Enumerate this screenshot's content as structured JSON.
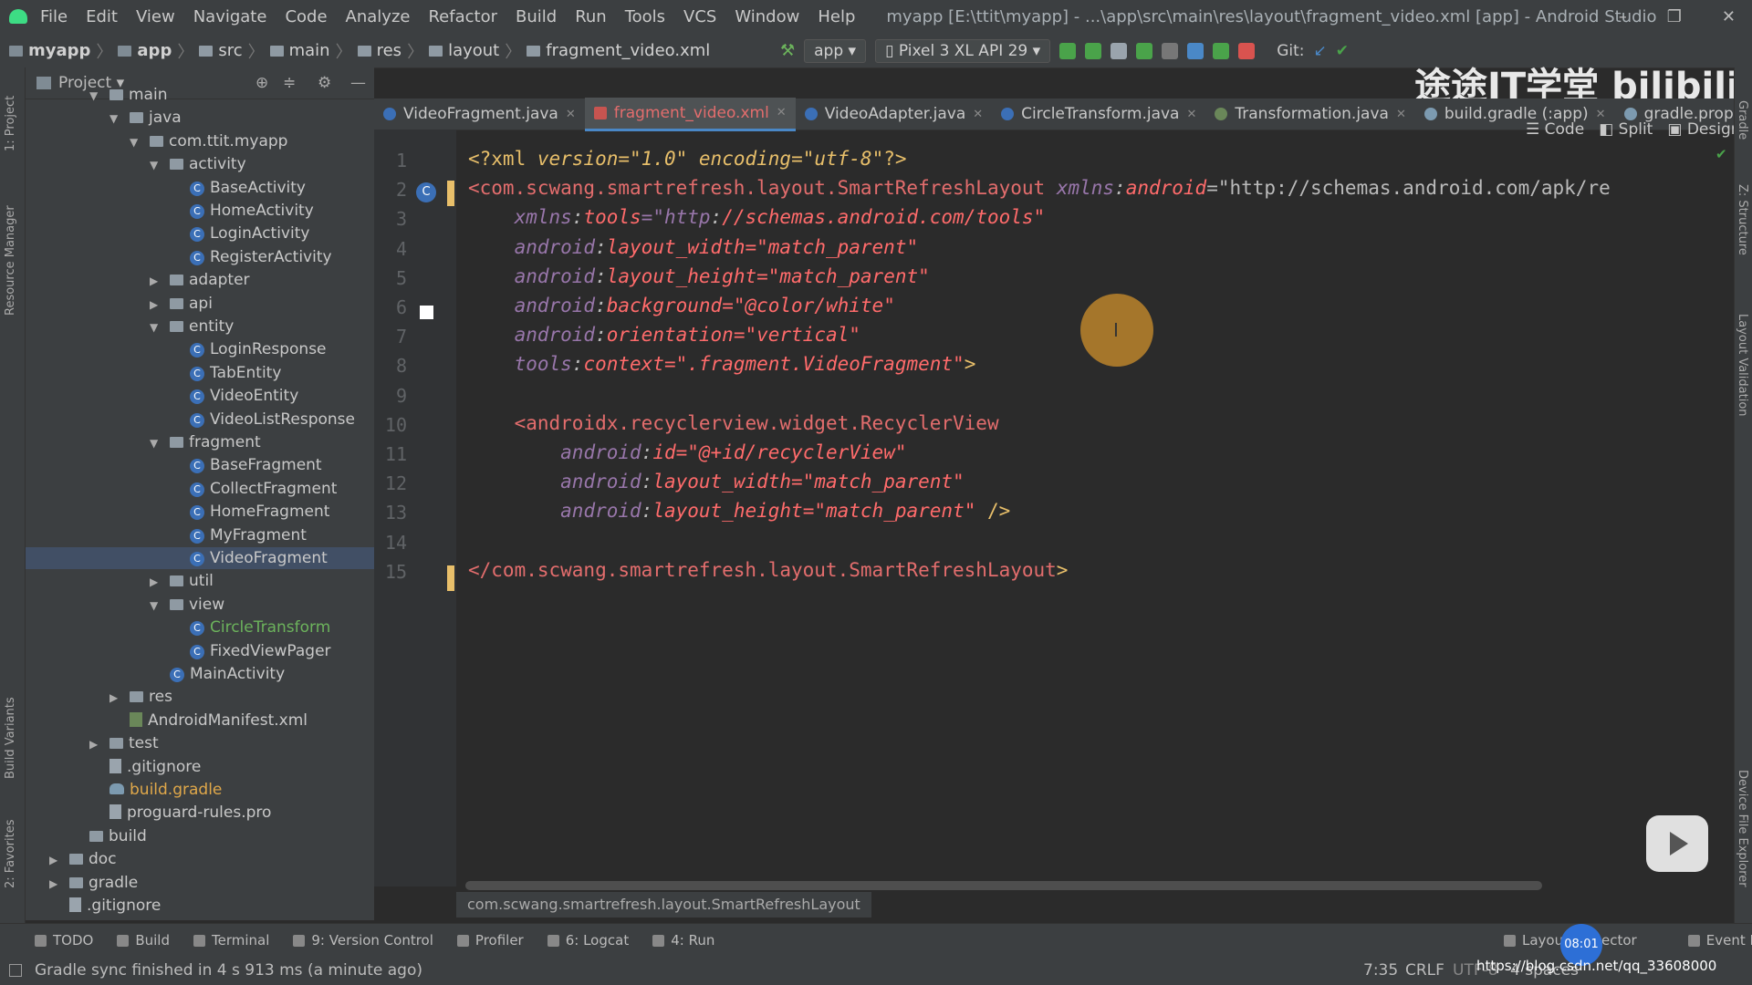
{
  "window": {
    "menu": [
      "File",
      "Edit",
      "View",
      "Navigate",
      "Code",
      "Analyze",
      "Refactor",
      "Build",
      "Run",
      "Tools",
      "VCS",
      "Window",
      "Help"
    ],
    "title": "myapp [E:\\ttit\\myapp] - ...\\app\\src\\main\\res\\layout\\fragment_video.xml [app] - Android Studio"
  },
  "navbar": {
    "crumbs": [
      "myapp",
      "app",
      "src",
      "main",
      "res",
      "layout",
      "fragment_video.xml"
    ],
    "run_config": "app",
    "device": "Pixel 3 XL API 29",
    "git_label": "Git:"
  },
  "project_panel": {
    "title": "Project",
    "tree": [
      {
        "label": "main",
        "indent": 1,
        "type": "folder",
        "arrow": "▼"
      },
      {
        "label": "java",
        "indent": 2,
        "type": "folder",
        "arrow": "▼"
      },
      {
        "label": "com.ttit.myapp",
        "indent": 3,
        "type": "folder",
        "arrow": "▼"
      },
      {
        "label": "activity",
        "indent": 4,
        "type": "folder",
        "arrow": "▼"
      },
      {
        "label": "BaseActivity",
        "indent": 5,
        "type": "class"
      },
      {
        "label": "HomeActivity",
        "indent": 5,
        "type": "class"
      },
      {
        "label": "LoginActivity",
        "indent": 5,
        "type": "class"
      },
      {
        "label": "RegisterActivity",
        "indent": 5,
        "type": "class"
      },
      {
        "label": "adapter",
        "indent": 4,
        "type": "folder",
        "arrow": "▶"
      },
      {
        "label": "api",
        "indent": 4,
        "type": "folder",
        "arrow": "▶"
      },
      {
        "label": "entity",
        "indent": 4,
        "type": "folder",
        "arrow": "▼"
      },
      {
        "label": "LoginResponse",
        "indent": 5,
        "type": "class"
      },
      {
        "label": "TabEntity",
        "indent": 5,
        "type": "class"
      },
      {
        "label": "VideoEntity",
        "indent": 5,
        "type": "class"
      },
      {
        "label": "VideoListResponse",
        "indent": 5,
        "type": "class"
      },
      {
        "label": "fragment",
        "indent": 4,
        "type": "folder",
        "arrow": "▼"
      },
      {
        "label": "BaseFragment",
        "indent": 5,
        "type": "class"
      },
      {
        "label": "CollectFragment",
        "indent": 5,
        "type": "class"
      },
      {
        "label": "HomeFragment",
        "indent": 5,
        "type": "class"
      },
      {
        "label": "MyFragment",
        "indent": 5,
        "type": "class"
      },
      {
        "label": "VideoFragment",
        "indent": 5,
        "type": "class",
        "selected": true
      },
      {
        "label": "util",
        "indent": 4,
        "type": "folder",
        "arrow": "▶"
      },
      {
        "label": "view",
        "indent": 4,
        "type": "folder",
        "arrow": "▼"
      },
      {
        "label": "CircleTransform",
        "indent": 5,
        "type": "class"
      },
      {
        "label": "FixedViewPager",
        "indent": 5,
        "type": "class"
      },
      {
        "label": "MainActivity",
        "indent": 4,
        "type": "class"
      },
      {
        "label": "res",
        "indent": 2,
        "type": "folder",
        "arrow": "▶"
      },
      {
        "label": "AndroidManifest.xml",
        "indent": 2,
        "type": "xml"
      },
      {
        "label": "test",
        "indent": 1,
        "type": "folder",
        "arrow": "▶"
      },
      {
        "label": ".gitignore",
        "indent": 1,
        "type": "file"
      },
      {
        "label": "build.gradle",
        "indent": 1,
        "type": "gradle"
      },
      {
        "label": "proguard-rules.pro",
        "indent": 1,
        "type": "file"
      },
      {
        "label": "build",
        "indent": 0,
        "type": "folder"
      },
      {
        "label": "doc",
        "indent": -1,
        "type": "folder",
        "arrow": "▶"
      },
      {
        "label": "gradle",
        "indent": -1,
        "type": "folder",
        "arrow": "▶"
      },
      {
        "label": ".gitignore",
        "indent": -1,
        "type": "file"
      }
    ]
  },
  "tabs": [
    {
      "label": "VideoFragment.java",
      "active": false
    },
    {
      "label": "fragment_video.xml",
      "active": true
    },
    {
      "label": "VideoAdapter.java",
      "active": false
    },
    {
      "label": "CircleTransform.java",
      "active": false
    },
    {
      "label": "Transformation.java",
      "active": false
    },
    {
      "label": "build.gradle (:app)",
      "active": false
    },
    {
      "label": "gradle.properties",
      "active": false
    }
  ],
  "view_modes": [
    "Code",
    "Split",
    "Design"
  ],
  "editor": {
    "line_numbers": [
      "1",
      "2",
      "3",
      "4",
      "5",
      "6",
      "7",
      "8",
      "9",
      "10",
      "11",
      "12",
      "13",
      "14",
      "15"
    ],
    "lines": [
      "<?xml version=\"1.0\" encoding=\"utf-8\"?>",
      "<com.scwang.smartrefresh.layout.SmartRefreshLayout xmlns:android=\"http://schemas.android.com/apk/re",
      "    xmlns:tools=\"http://schemas.android.com/tools\"",
      "    android:layout_width=\"match_parent\"",
      "    android:layout_height=\"match_parent\"",
      "    android:background=\"@color/white\"",
      "    android:orientation=\"vertical\"",
      "    tools:context=\".fragment.VideoFragment\">",
      "",
      "    <androidx.recyclerview.widget.RecyclerView",
      "        android:id=\"@+id/recyclerView\"",
      "        android:layout_width=\"match_parent\"",
      "        android:layout_height=\"match_parent\" />",
      "",
      "</com.scwang.smartrefresh.layout.SmartRefreshLayout>"
    ],
    "breadcrumb": "com.scwang.smartrefresh.layout.SmartRefreshLayout"
  },
  "tool_windows": [
    "TODO",
    "Build",
    "Terminal",
    "9: Version Control",
    "Profiler",
    "6: Logcat",
    "4: Run"
  ],
  "tool_windows_right": [
    "Layout Inspector",
    "Event Log"
  ],
  "left_stripe": [
    "1: Project",
    "Resource Manager",
    "Build Variants",
    "2: Favorites"
  ],
  "right_stripe": [
    "Gradle",
    "Z: Structure",
    "Layout Validation",
    "Device File Explorer"
  ],
  "status": {
    "message": "Gradle sync finished in 4 s 913 ms (a minute ago)",
    "position": "7:35",
    "line_sep": "CRLF",
    "encoding": "UTF-8",
    "indent": "4 spaces"
  },
  "overlay": {
    "watermark": "途途IT学堂 bilibili",
    "clock": "08:01",
    "url": "https://blog.csdn.net/qq_33608000"
  }
}
